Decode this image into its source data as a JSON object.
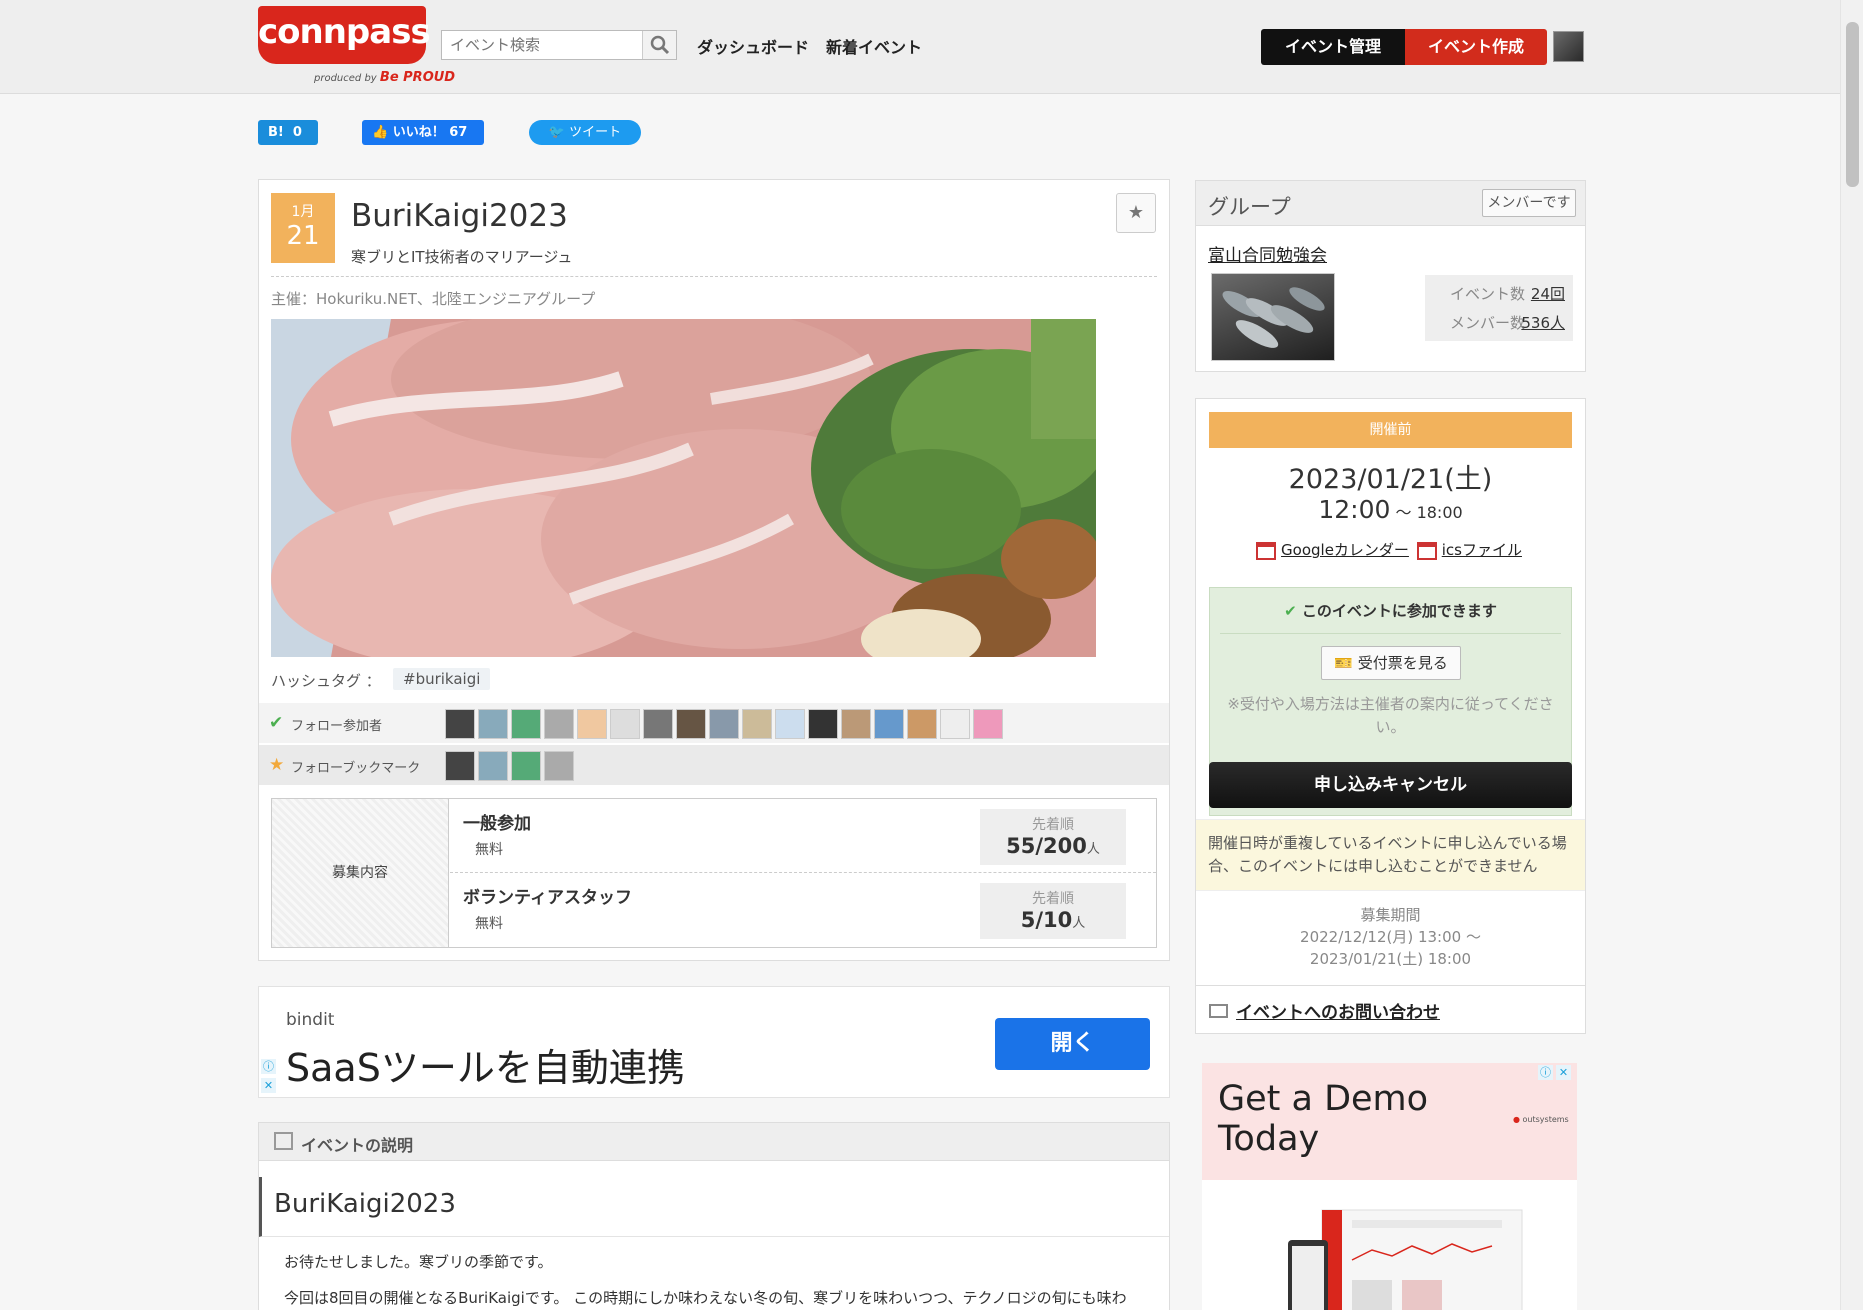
{
  "header": {
    "logo": "connpass",
    "logo_sub": "produced by",
    "logo_sub_brand": "Be PROUD",
    "search_placeholder": "イベント検索",
    "nav": [
      "ダッシュボード",
      "新着イベント"
    ],
    "manage_label": "イベント管理",
    "create_label": "イベント作成"
  },
  "social": {
    "hatena_label": "B!",
    "hatena_count": "0",
    "fb_label": "いいね！",
    "fb_count": "67",
    "tweet_label": "ツイート"
  },
  "event": {
    "month": "1月",
    "day": "21",
    "title": "BuriKaigi2023",
    "subtitle": "寒ブリとIT技術者のマリアージュ",
    "organizer": "主催：Hokuriku.NET、北陸エンジニアグループ",
    "hashtag_label": "ハッシュタグ ：",
    "hashtag": "#burikaigi",
    "follow_participants_label": "フォロー参加者",
    "follow_bookmark_label": "フォローブックマーク",
    "follow_participant_count": 17,
    "follow_bookmark_count": 4
  },
  "recruit": {
    "heading": "募集内容",
    "rows": [
      {
        "name": "一般参加",
        "price": "無料",
        "order": "先着順",
        "count": "55/200",
        "unit": "人"
      },
      {
        "name": "ボランティアスタッフ",
        "price": "無料",
        "order": "先着順",
        "count": "5/10",
        "unit": "人"
      }
    ]
  },
  "ad1": {
    "brand": "bindit",
    "headline": "SaaSツールを自動連携",
    "button": "開く"
  },
  "description": {
    "heading": "イベントの説明",
    "title": "BuriKaigi2023",
    "p1": "お待たせしました。寒ブリの季節です。",
    "p2": "今回は8回目の開催となるBuriKaigiです。 この時期にしか味わえない冬の旬、寒ブリを味わいつつ、テクノロジの旬にも味わ"
  },
  "group": {
    "heading": "グループ",
    "member_badge": "メンバーです",
    "name": "富山合同勉強会",
    "events_label": "イベント数",
    "events_value": "24回",
    "members_label": "メンバー数",
    "members_value": "536人"
  },
  "info": {
    "status": "開催前",
    "date": "2023/01/21(土)",
    "time_start": "12:00",
    "time_sep": " ～ ",
    "time_end": "18:00",
    "google_cal": "Googleカレンダー",
    "ics": "icsファイル",
    "can_join": "このイベントに参加できます",
    "ticket": "受付票を見る",
    "note": "※受付や入場方法は主催者の案内に従ってください。",
    "cancel": "申し込みキャンセル",
    "warning": "開催日時が重複しているイベントに申し込んでいる場合、このイベントには申し込むことができません",
    "period_label": "募集期間",
    "period_start": "2022/12/12(月) 13:00 ～",
    "period_end": "2023/01/21(土) 18:00",
    "contact": "イベントへのお問い合わせ"
  },
  "ad2": {
    "headline": "Get a Demo Today",
    "brand": "outsystems"
  },
  "colors": {
    "brand_red": "#d9261c",
    "orange": "#f2b25c"
  }
}
